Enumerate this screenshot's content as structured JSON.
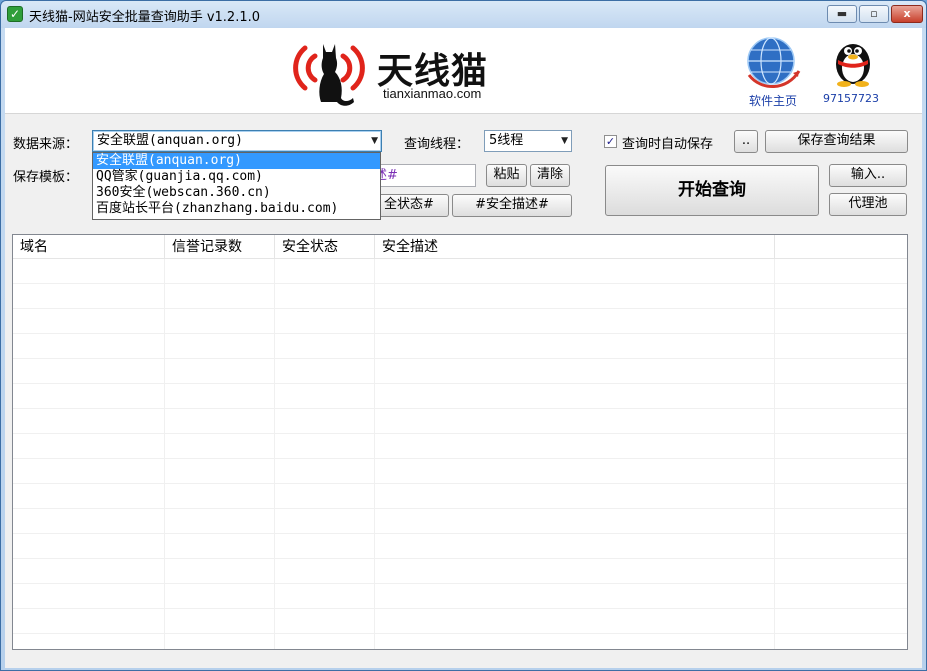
{
  "window": {
    "title": "天线猫-网站安全批量查询助手 v1.2.1.0",
    "min_glyph": "▬",
    "max_glyph": "▫",
    "close_glyph": "x"
  },
  "banner": {
    "logo_cn": "天线猫",
    "logo_en": "tianxianmao.com",
    "home_label": "软件主页",
    "qq_number": "97157723"
  },
  "form": {
    "source_label": "数据来源：",
    "source_value": "安全联盟(anquan.org)",
    "source_options": [
      "安全联盟(anquan.org)",
      "QQ管家(guanjia.qq.com)",
      "360安全(webscan.360.cn)",
      "百度站长平台(zhanzhang.baidu.com)"
    ],
    "threads_label": "查询线程：",
    "threads_value": "5线程",
    "autosave_label": "查询时自动保存",
    "autosave_checked": true,
    "browse_label": "..",
    "save_results_label": "保存查询结果",
    "template_label": "保存模板：",
    "template_value_visible": "述#",
    "paste_label": "粘贴",
    "clear_label": "清除",
    "tag_status_label": "全状态#",
    "tag_desc_label": "#安全描述#",
    "start_label": "开始查询",
    "input_label": "输入..",
    "proxy_label": "代理池"
  },
  "table": {
    "columns": [
      "域名",
      "信誉记录数",
      "安全状态",
      "安全描述",
      ""
    ]
  },
  "colors": {
    "selection": "#3399ff",
    "template_text": "#7b2fb5",
    "link": "#1a3ea8",
    "logo_red": "#e0241b"
  }
}
